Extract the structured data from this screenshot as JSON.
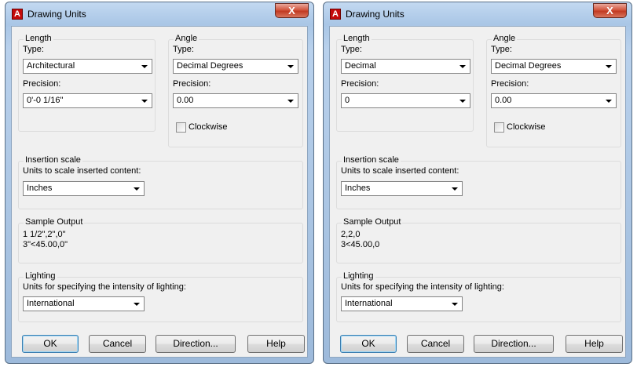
{
  "dialogs": [
    {
      "title": "Drawing Units",
      "close_label": "X",
      "icon_letter": "A",
      "length": {
        "legend": "Length",
        "type_label": "Type:",
        "type_value": "Architectural",
        "precision_label": "Precision:",
        "precision_value": "0'-0 1/16\""
      },
      "angle": {
        "legend": "Angle",
        "type_label": "Type:",
        "type_value": "Decimal Degrees",
        "precision_label": "Precision:",
        "precision_value": "0.00",
        "clockwise_label": "Clockwise",
        "clockwise_checked": false
      },
      "insertion": {
        "legend": "Insertion scale",
        "label": "Units to scale inserted content:",
        "value": "Inches"
      },
      "sample": {
        "legend": "Sample Output",
        "line1": "1 1/2\",2\",0\"",
        "line2": "3\"<45.00,0\""
      },
      "lighting": {
        "legend": "Lighting",
        "label": "Units for specifying the intensity of lighting:",
        "value": "International"
      },
      "buttons": {
        "ok": "OK",
        "cancel": "Cancel",
        "direction": "Direction...",
        "help": "Help"
      }
    },
    {
      "title": "Drawing Units",
      "close_label": "X",
      "icon_letter": "A",
      "length": {
        "legend": "Length",
        "type_label": "Type:",
        "type_value": "Decimal",
        "precision_label": "Precision:",
        "precision_value": "0"
      },
      "angle": {
        "legend": "Angle",
        "type_label": "Type:",
        "type_value": "Decimal Degrees",
        "precision_label": "Precision:",
        "precision_value": "0.00",
        "clockwise_label": "Clockwise",
        "clockwise_checked": false
      },
      "insertion": {
        "legend": "Insertion scale",
        "label": "Units to scale inserted content:",
        "value": "Inches"
      },
      "sample": {
        "legend": "Sample Output",
        "line1": "2,2,0",
        "line2": "3<45.00,0"
      },
      "lighting": {
        "legend": "Lighting",
        "label": "Units for specifying the intensity of lighting:",
        "value": "International"
      },
      "buttons": {
        "ok": "OK",
        "cancel": "Cancel",
        "direction": "Direction...",
        "help": "Help"
      }
    }
  ]
}
